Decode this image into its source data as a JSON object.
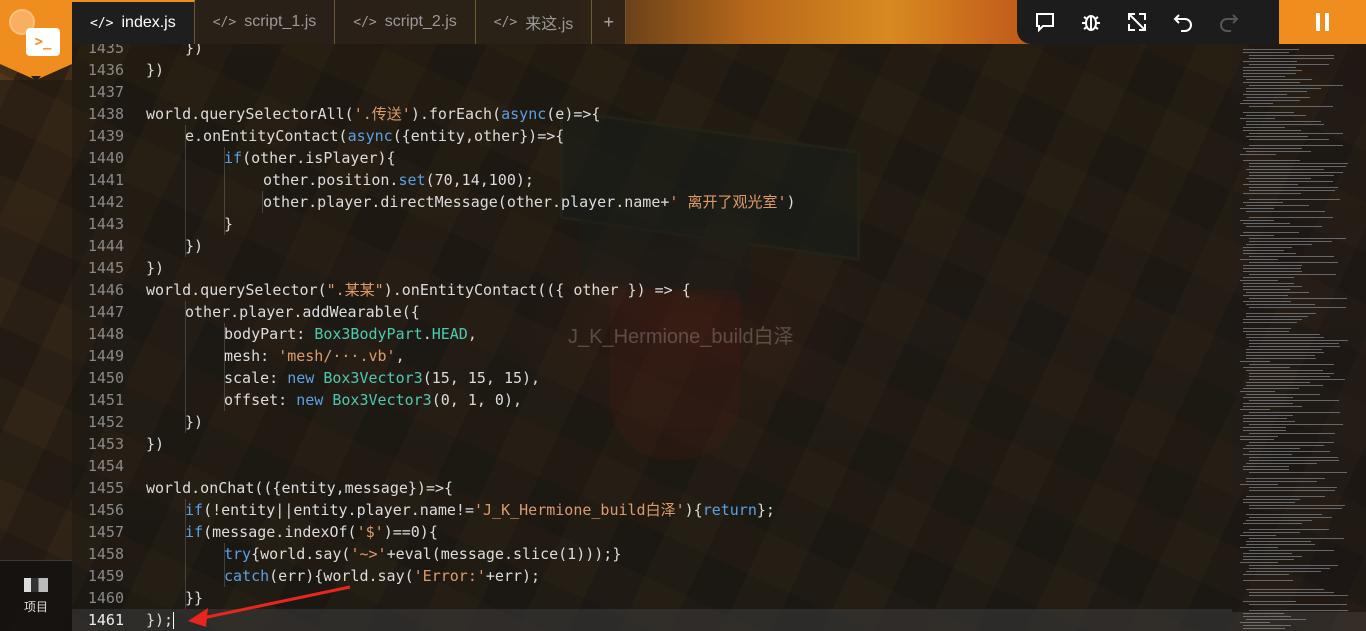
{
  "tabs": [
    {
      "label": "index.js",
      "icon": "code-icon",
      "active": true
    },
    {
      "label": "script_1.js",
      "icon": "code-icon",
      "active": false
    },
    {
      "label": "script_2.js",
      "icon": "code-icon",
      "active": false
    },
    {
      "label": "来这.js",
      "icon": "code-icon",
      "active": false
    }
  ],
  "tab_add_label": "+",
  "toolbar": {
    "icons": [
      "chat-icon",
      "debug-bug-icon",
      "expand-icon",
      "undo-icon",
      "redo-icon"
    ],
    "pause_icon": "pause-icon"
  },
  "sidebar": {
    "project_label": "项目"
  },
  "watermark": "J_K_Hermione_build白泽",
  "current_line": 1461,
  "code": [
    {
      "n": "1435",
      "indent": 1,
      "html": "})"
    },
    {
      "n": "1436",
      "indent": 0,
      "html": "})"
    },
    {
      "n": "1437",
      "indent": 0,
      "html": ""
    },
    {
      "n": "1438",
      "indent": 0,
      "html": "world.querySelectorAll(<span class=\"s\">'.传送'</span>).forEach(<span class=\"k\">async</span>(e)=>{"
    },
    {
      "n": "1439",
      "indent": 1,
      "html": "e.onEntityContact(<span class=\"k\">async</span>({entity,other})=>{"
    },
    {
      "n": "1440",
      "indent": 2,
      "html": "<span class=\"k\">if</span>(other.isPlayer){"
    },
    {
      "n": "1441",
      "indent": 3,
      "html": "other.position.<span class=\"k\">set</span>(70,14,100);"
    },
    {
      "n": "1442",
      "indent": 3,
      "html": "other.player.directMessage(other.player.name+<span class=\"s\">' 离开了观光室'</span>)"
    },
    {
      "n": "1443",
      "indent": 2,
      "html": "}"
    },
    {
      "n": "1444",
      "indent": 1,
      "html": "})"
    },
    {
      "n": "1445",
      "indent": 0,
      "html": "})"
    },
    {
      "n": "1446",
      "indent": 0,
      "html": "world.querySelector(<span class=\"s\">\".某某\"</span>).onEntityContact(({ other }) => {"
    },
    {
      "n": "1447",
      "indent": 1,
      "html": "other.player.addWearable({"
    },
    {
      "n": "1448",
      "indent": 2,
      "html": "bodyPart: <span class=\"t\">Box3BodyPart</span>.<span class=\"t\">HEAD</span>,"
    },
    {
      "n": "1449",
      "indent": 2,
      "html": "mesh: <span class=\"s\">'mesh/···.vb'</span>,"
    },
    {
      "n": "1450",
      "indent": 2,
      "html": "scale: <span class=\"k\">new</span> <span class=\"t\">Box3Vector3</span>(15, 15, 15),"
    },
    {
      "n": "1451",
      "indent": 2,
      "html": "offset: <span class=\"k\">new</span> <span class=\"t\">Box3Vector3</span>(0, 1, 0),"
    },
    {
      "n": "1452",
      "indent": 1,
      "html": "})"
    },
    {
      "n": "1453",
      "indent": 0,
      "html": "})"
    },
    {
      "n": "1454",
      "indent": 0,
      "html": ""
    },
    {
      "n": "1455",
      "indent": 0,
      "html": "world.onChat(({entity,message})=>{"
    },
    {
      "n": "1456",
      "indent": 1,
      "html": "<span class=\"k\">if</span>(!entity||entity.player.name!=<span class=\"s\">'J_K_Hermione_build白泽'</span>){<span class=\"k\">return</span>};"
    },
    {
      "n": "1457",
      "indent": 1,
      "html": "<span class=\"k\">if</span>(message.indexOf(<span class=\"s\">'$'</span>)==0){"
    },
    {
      "n": "1458",
      "indent": 2,
      "html": "<span class=\"k\">try</span>{world.say(<span class=\"s\">'~>'</span>+eval(message.slice(1)));}"
    },
    {
      "n": "1459",
      "indent": 2,
      "html": "<span class=\"k\">catch</span>(err){world.say(<span class=\"s\">'Error:'</span>+err);"
    },
    {
      "n": "1460",
      "indent": 1,
      "html": "}}"
    },
    {
      "n": "1461",
      "indent": 0,
      "html": "});"
    }
  ]
}
